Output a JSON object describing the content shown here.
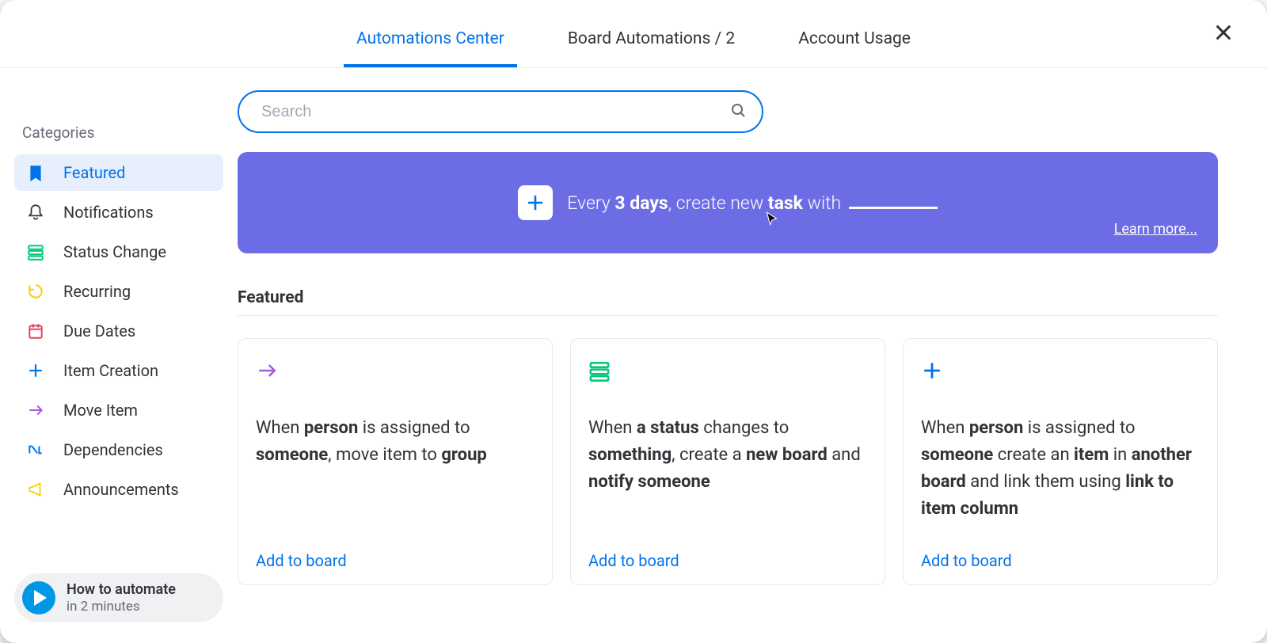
{
  "header": {
    "tabs": [
      {
        "label": "Automations Center",
        "active": true
      },
      {
        "label": "Board Automations / 2",
        "active": false
      },
      {
        "label": "Account Usage",
        "active": false
      }
    ]
  },
  "sidebar": {
    "title": "Categories",
    "items": [
      {
        "label": "Featured",
        "icon": "bookmark-icon",
        "color": "#0073ea",
        "active": true
      },
      {
        "label": "Notifications",
        "icon": "bell-icon",
        "color": "#323338",
        "active": false
      },
      {
        "label": "Status Change",
        "icon": "status-icon",
        "color": "#00c875",
        "active": false
      },
      {
        "label": "Recurring",
        "icon": "recurring-icon",
        "color": "#ffcb00",
        "active": false
      },
      {
        "label": "Due Dates",
        "icon": "calendar-icon",
        "color": "#e2445c",
        "active": false
      },
      {
        "label": "Item Creation",
        "icon": "plus-icon",
        "color": "#0073ea",
        "active": false
      },
      {
        "label": "Move Item",
        "icon": "arrow-icon",
        "color": "#a25ddc",
        "active": false
      },
      {
        "label": "Dependencies",
        "icon": "dependency-icon",
        "color": "#0073ea",
        "active": false
      },
      {
        "label": "Announcements",
        "icon": "megaphone-icon",
        "color": "#ffcb00",
        "active": false
      }
    ],
    "howto": {
      "title": "How to automate",
      "sub": "in 2 minutes"
    }
  },
  "search": {
    "placeholder": "Search"
  },
  "banner": {
    "prefix": "Every ",
    "bold1": "3 days",
    "mid": ", create new ",
    "bold2": "task",
    "suffix": " with ",
    "learn_more": "Learn more..."
  },
  "section": {
    "title": "Featured"
  },
  "cards": [
    {
      "icon": "arrow-icon",
      "icon_color": "#a25ddc",
      "segments": [
        "When ",
        "person",
        " is assigned to ",
        "someone",
        ", move item to ",
        "group"
      ],
      "bold_idx": [
        1,
        3,
        5
      ],
      "action": "Add to board"
    },
    {
      "icon": "status-icon",
      "icon_color": "#00c875",
      "segments": [
        "When ",
        "a status",
        " changes to ",
        "something",
        ", create a ",
        "new board",
        " and ",
        "notify someone"
      ],
      "bold_idx": [
        1,
        3,
        5,
        7
      ],
      "action": "Add to board"
    },
    {
      "icon": "plus-icon",
      "icon_color": "#0073ea",
      "segments": [
        "When ",
        "person",
        " is assigned to ",
        "someone",
        " create an ",
        "item",
        " in ",
        "another board",
        " and link them using ",
        "link to item column"
      ],
      "bold_idx": [
        1,
        3,
        5,
        7,
        9
      ],
      "action": "Add to board"
    }
  ]
}
